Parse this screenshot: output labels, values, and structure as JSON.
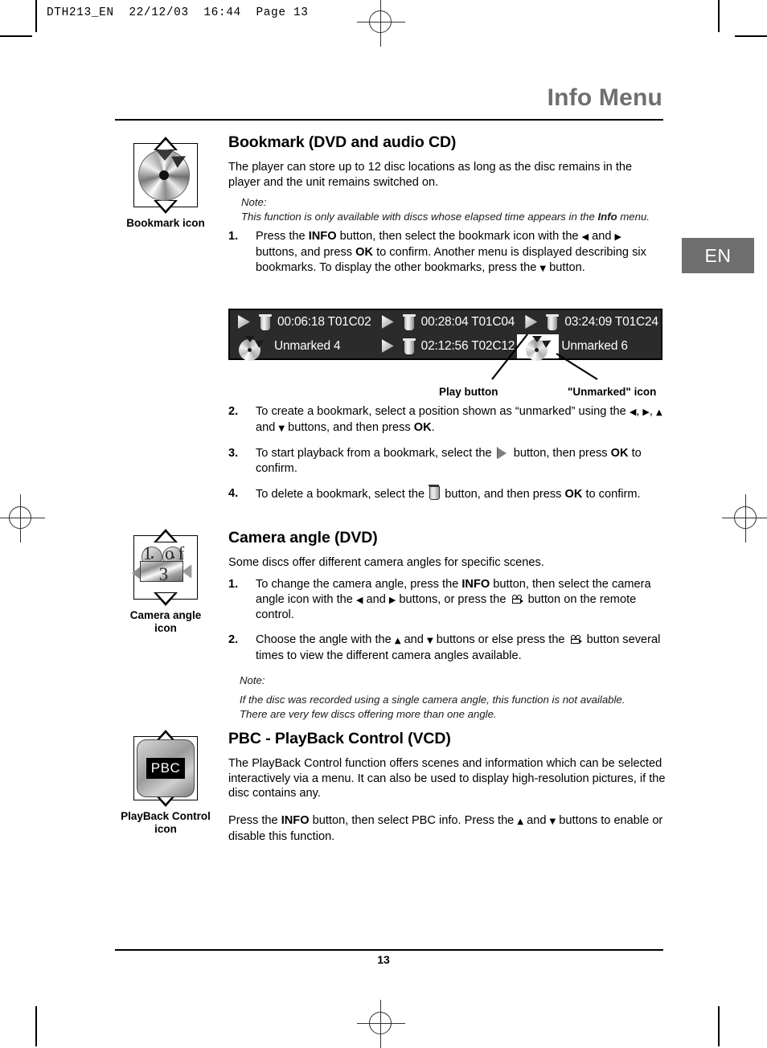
{
  "printer_header": "DTH213_EN  22/12/03  16:44  Page 13",
  "page_title": "Info Menu",
  "language_tab": "EN",
  "page_number": "13",
  "colors": {
    "title_gray": "#6e6e6e",
    "tab_gray": "#6e6e6e",
    "osd_background": "#2b2b2b",
    "osd_text": "#ffffff"
  },
  "margin_icons": {
    "bookmark": {
      "caption": "Bookmark icon",
      "name": "bookmark-icon"
    },
    "camera_angle": {
      "caption_line1": "Camera angle",
      "caption_line2": "icon",
      "overlay_text": "1 of 3",
      "name": "camera-angle-icon"
    },
    "pbc": {
      "caption_line1": "PlayBack Control",
      "caption_line2": "icon",
      "badge_text": "PBC",
      "name": "playback-control-icon"
    }
  },
  "sections": {
    "bookmark": {
      "heading": "Bookmark (DVD and audio CD)",
      "intro": "The player can store up to 12 disc locations as long as the disc remains in the player and the unit remains switched on.",
      "note_label": "Note:",
      "note_text_a": "This function is only available with discs whose elapsed time appears in the ",
      "note_bold": "Info",
      "note_text_b": " menu.",
      "steps": [
        {
          "num": "1.",
          "p1": "Press the ",
          "b1": "INFO",
          "p2": " button, then select the bookmark icon with the ",
          "p3": " and ",
          "p4": " buttons, and press ",
          "b2": "OK",
          "p5": " to confirm. Another menu is displayed describing six bookmarks. To display the other bookmarks, press the ",
          "p6": " button."
        },
        {
          "num": "2.",
          "p1": "To create a bookmark, select a position shown as “unmarked” using the ",
          "p2": ", ",
          "p3": ", ",
          "p4": " and ",
          "p5": " buttons, and then press ",
          "b1": "OK",
          "p6": "."
        },
        {
          "num": "3.",
          "p1": "To start playback from a bookmark, select the ",
          "p2": " button, then press ",
          "b1": "OK",
          "p3": " to confirm."
        },
        {
          "num": "4.",
          "p1": "To delete a bookmark, select the ",
          "p2": " button, and then press ",
          "b1": "OK",
          "p3": " to confirm."
        }
      ]
    },
    "camera_angle": {
      "heading": "Camera angle (DVD)",
      "intro": "Some discs offer different camera angles for specific scenes.",
      "steps": [
        {
          "num": "1.",
          "p1": "To change the camera angle, press the ",
          "b1": "INFO",
          "p2": " button, then select the camera angle icon with the ",
          "p3": " and ",
          "p4": " buttons, or press the ",
          "p5": " button on the remote control."
        },
        {
          "num": "2.",
          "p1": "Choose the angle with the ",
          "p2": " and ",
          "p3": " buttons or else press the ",
          "p4": " button several times to view the different camera angles available."
        }
      ],
      "note_label": "Note:",
      "note_text_1": "If the disc was recorded using a single camera angle, this function is not available.",
      "note_text_2": "There are very few discs offering more than one angle."
    },
    "pbc": {
      "heading": "PBC - PlayBack Control (VCD)",
      "intro": "The PlayBack Control function offers scenes and information which can be selected interactively via a menu. It can also be used to display high-resolution pictures, if the disc contains any.",
      "para2_a": "Press the ",
      "para2_b": "INFO",
      "para2_c": " button, then select PBC info. Press the ",
      "para2_d": " and ",
      "para2_e": " buttons to enable or disable this function."
    }
  },
  "osd_menu": {
    "rows": [
      [
        {
          "type": "bookmarked",
          "label": "00:06:18 T01C02"
        },
        {
          "type": "bookmarked",
          "label": "00:28:04 T01C04"
        },
        {
          "type": "bookmarked",
          "label": "03:24:09 T01C24"
        }
      ],
      [
        {
          "type": "unmarked",
          "label": "Unmarked 4"
        },
        {
          "type": "bookmarked",
          "label": "02:12:56 T02C12"
        },
        {
          "type": "unmarked",
          "label": "Unmarked 6"
        }
      ]
    ]
  },
  "callouts": {
    "play_button": "Play button",
    "unmarked_icon": "\"Unmarked\" icon"
  }
}
